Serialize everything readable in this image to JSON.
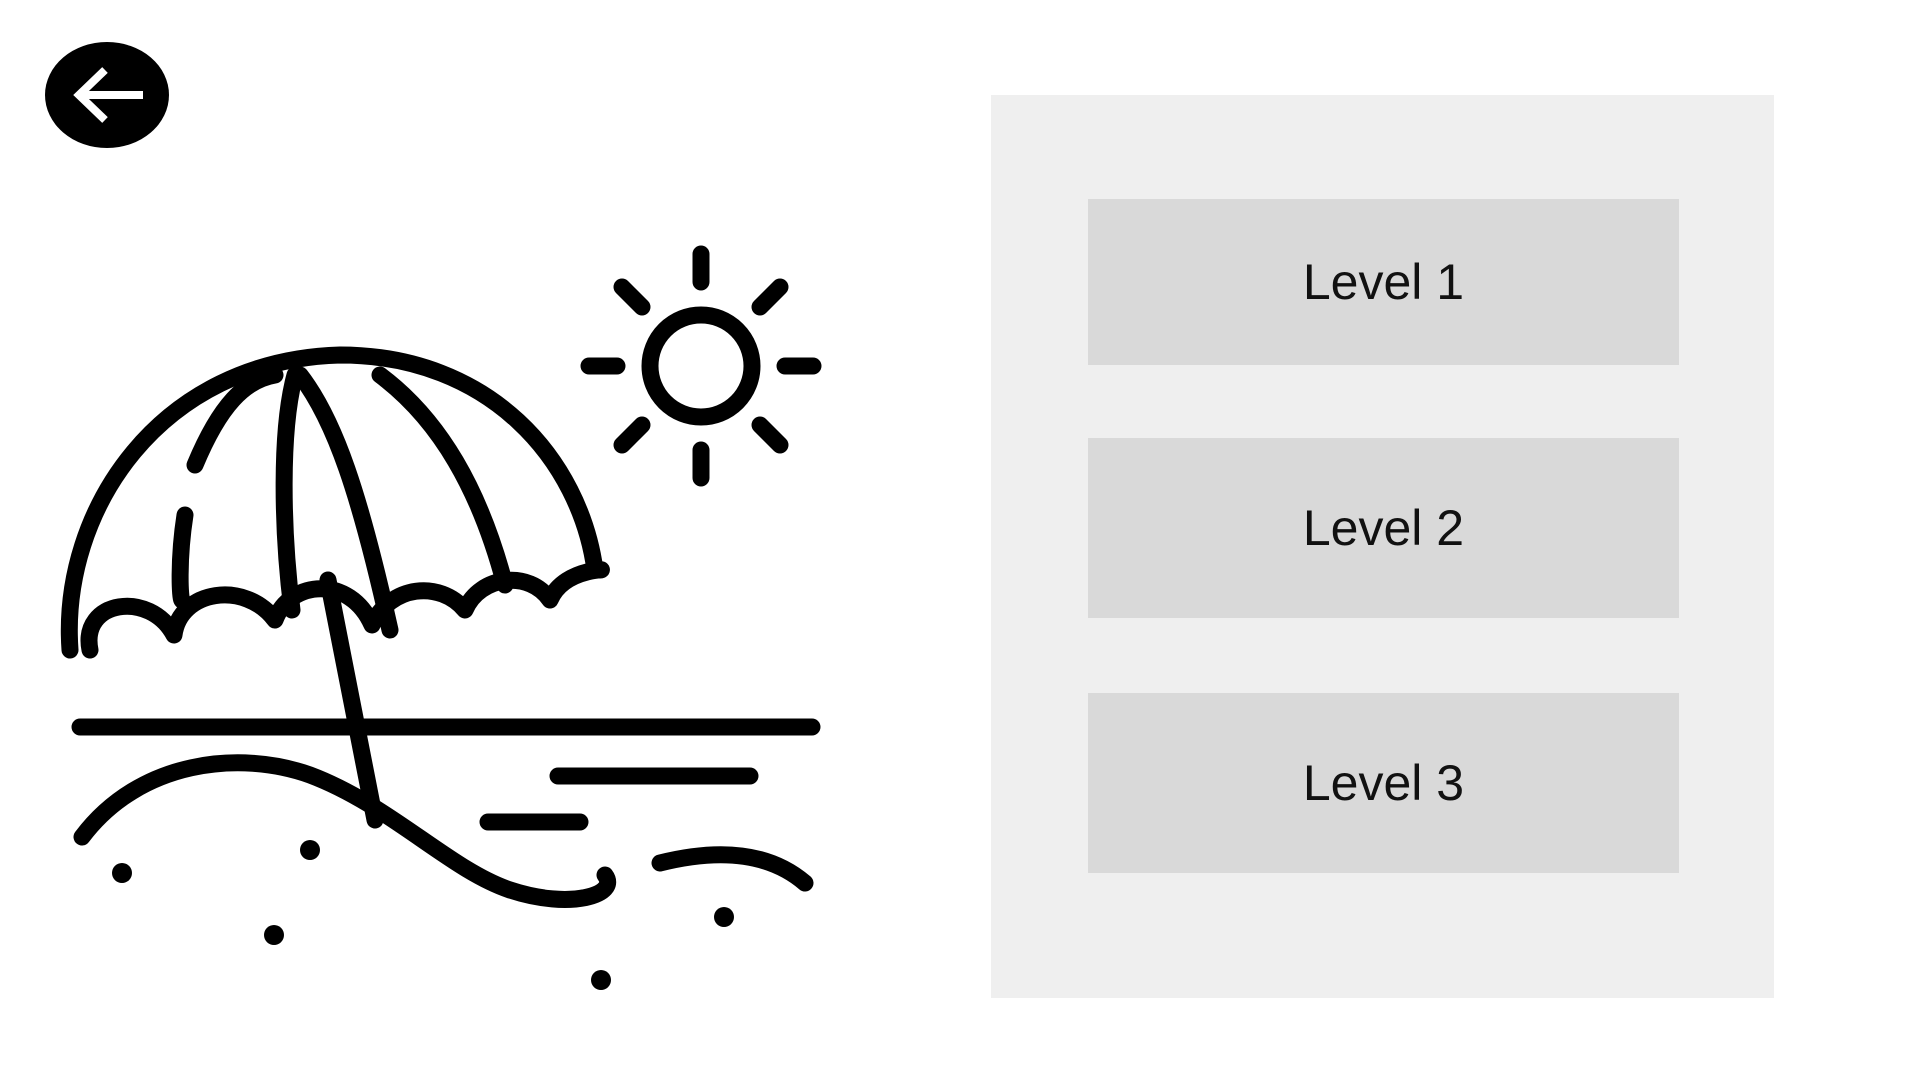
{
  "navigation": {
    "back_icon": "arrow-left-icon"
  },
  "illustration": {
    "icon": "beach-umbrella-sun-icon"
  },
  "levels": [
    {
      "label": "Level 1"
    },
    {
      "label": "Level 2"
    },
    {
      "label": "Level 3"
    }
  ],
  "colors": {
    "background": "#ffffff",
    "panel": "#efefef",
    "button": "#d9d9d9",
    "ink": "#000000"
  }
}
